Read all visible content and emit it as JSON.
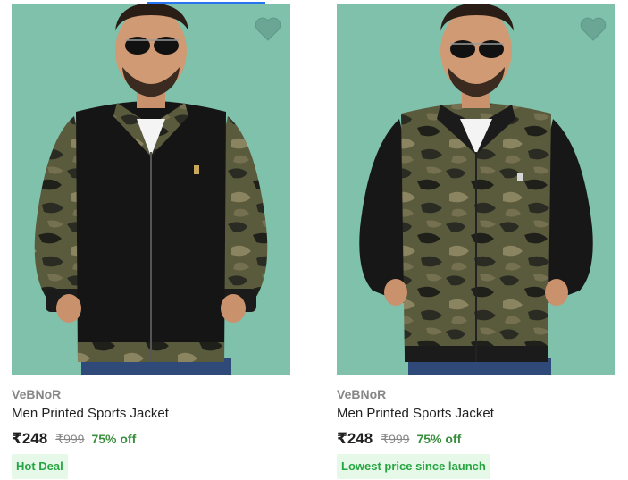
{
  "products": [
    {
      "brand": "VeBNoR",
      "title": "Men Printed Sports Jacket",
      "price": "₹248",
      "mrp": "₹999",
      "discount": "75% off",
      "badge": "Hot Deal",
      "image": "man-in-black-jacket-with-camo-sleeves",
      "wishlist_icon": "heart-icon"
    },
    {
      "brand": "VeBNoR",
      "title": "Men Printed Sports Jacket",
      "price": "₹248",
      "mrp": "₹999",
      "discount": "75% off",
      "badge": "Lowest price since launch",
      "image": "man-in-camo-jacket-with-black-sleeves",
      "wishlist_icon": "heart-icon"
    }
  ],
  "colors": {
    "image_background": "#7fc1ab",
    "price_discount": "#388e3c",
    "badge_text": "#26a541",
    "badge_background": "#e6f8e8",
    "active_tab_indicator": "#2874f0"
  }
}
